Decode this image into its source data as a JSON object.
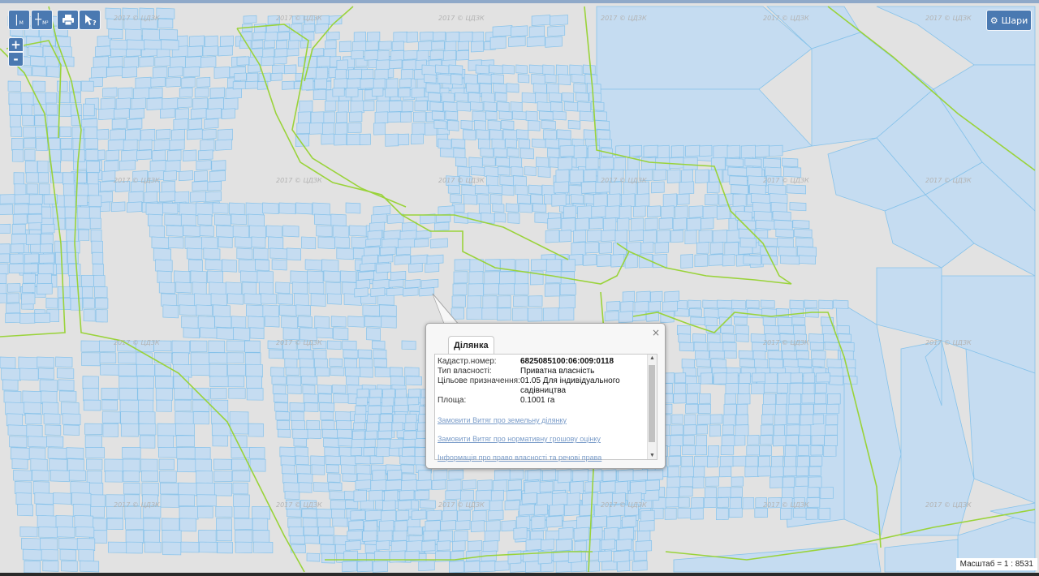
{
  "colors": {
    "map_background": "#e2e2e2",
    "parcel_fill": "#c5dcf1",
    "parcel_stroke": "#86c2ea",
    "boundary_line": "#9ad33a",
    "button_blue": "#4a79b1"
  },
  "toolbar": {
    "measure_distance_icon": "ruler-m-icon",
    "measure_distance_sub": "M",
    "measure_area_icon": "ruler-area-icon",
    "measure_area_sub": "M²",
    "print_icon": "printer-icon",
    "identify_icon": "cursor-question-icon"
  },
  "zoom": {
    "in_label": "+",
    "out_label": "-"
  },
  "layers_button": {
    "icon": "gear-icon",
    "label": "Шари"
  },
  "scale_label": "Масштаб = 1 : 8531",
  "watermark": "2017 © ЦДЗК",
  "popup": {
    "close_label": "×",
    "tab_label": "Ділянка",
    "fields": [
      {
        "label": "Кадастр.номер:",
        "value": "6825085100:06:009:0118",
        "bold": true
      },
      {
        "label": "Тип власності:",
        "value": "Приватна власність"
      },
      {
        "label": "Цільове призначення:",
        "value": "01.05 Для індивідуального садівництва"
      },
      {
        "label": "Площа:",
        "value": "0.1001 га"
      }
    ],
    "links": [
      "Замовити Витяг про земельну ділянку",
      "Замовити Витяг про нормативну грошову оцінку",
      "Інформація про право власності та речові права"
    ]
  }
}
